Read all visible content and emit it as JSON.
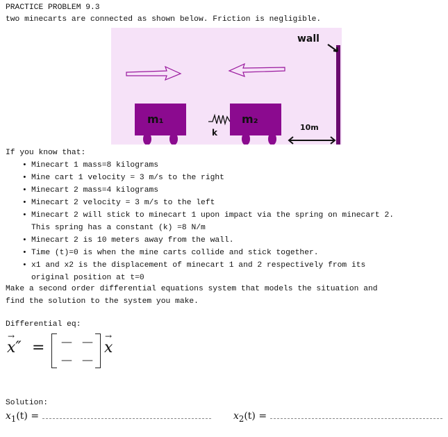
{
  "header": {
    "title": "PRACTICE PROBLEM 9.3",
    "intro": "two minecarts are connected as shown below. Friction is negligible."
  },
  "diagram": {
    "background_color": "#f6e2f8",
    "cart_color": "#8b0a8f",
    "wall_color": "#6a0a6e",
    "arrow_color": "#9a1a9e",
    "labels": {
      "wall": "wall",
      "cart1": "m₁",
      "cart2": "m₂",
      "spring": "k",
      "distance": "10m"
    },
    "arrows": [
      {
        "name": "cart1-velocity",
        "direction": "right"
      },
      {
        "name": "cart2-velocity",
        "direction": "left"
      }
    ]
  },
  "given": {
    "heading": "If you know that:",
    "bullet": "•",
    "items": [
      [
        "Minecart 1 mass=8 kilograms"
      ],
      [
        "Mine cart 1 velocity = 3 m/s to the right"
      ],
      [
        "Minecart 2 mass=4 kilograms"
      ],
      [
        "Minecart 2 velocity = 3 m/s to the left"
      ],
      [
        "Minecart 2 will stick to minecart 1 upon impact via the spring on minecart 2.",
        "This spring has a constant (k) =8 N/m"
      ],
      [
        "Minecart 2 is 10 meters away from the wall."
      ],
      [
        "Time (t)=0 is when the mine carts collide and stick together."
      ],
      [
        "x1 and x2 is the displacement of minecart 1 and 2 respectively from its",
        "original position at t=0"
      ]
    ]
  },
  "task": {
    "line1": "Make a second order differential equations system that models the situation and",
    "line2": "find the solution to the system you make."
  },
  "differential": {
    "label": "Differential eq:",
    "lhs": "x″",
    "equals": "=",
    "matrix": [
      [
        "—",
        "—"
      ],
      [
        "—",
        "—"
      ]
    ],
    "rhs": "x"
  },
  "solution": {
    "label": "Solution:",
    "x1": {
      "name": "x",
      "sub": "1",
      "arg": "(t) ="
    },
    "x2": {
      "name": "x",
      "sub": "2",
      "arg": "(t) ="
    }
  }
}
